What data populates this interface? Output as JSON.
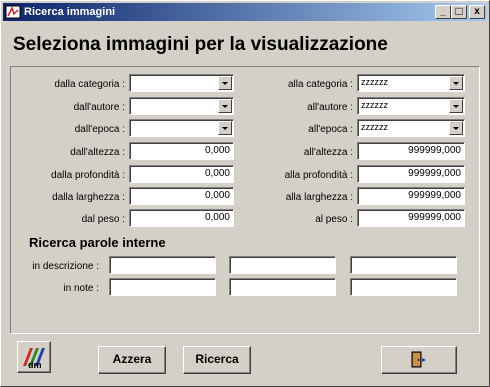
{
  "window": {
    "title": "Ricerca immagini",
    "minimize": "_",
    "maximize": "□",
    "close": "x"
  },
  "heading": "Seleziona immagini per la visualizzazione",
  "from": {
    "categoria": {
      "label": "dalla categoria :",
      "value": ""
    },
    "autore": {
      "label": "dall'autore :",
      "value": ""
    },
    "epoca": {
      "label": "dall'epoca :",
      "value": ""
    },
    "altezza": {
      "label": "dall'altezza :",
      "value": "0,000"
    },
    "profondita": {
      "label": "dalla profondità :",
      "value": "0,000"
    },
    "larghezza": {
      "label": "dalla larghezza :",
      "value": "0,000"
    },
    "peso": {
      "label": "dal peso :",
      "value": "0,000"
    }
  },
  "to": {
    "categoria": {
      "label": "alla categoria :",
      "value": "zzzzzz"
    },
    "autore": {
      "label": "all'autore :",
      "value": "zzzzzz"
    },
    "epoca": {
      "label": "all'epoca :",
      "value": "zzzzzz"
    },
    "altezza": {
      "label": "all'altezza :",
      "value": "999999,000"
    },
    "profondita": {
      "label": "alla profondità :",
      "value": "999999,000"
    },
    "larghezza": {
      "label": "alla larghezza :",
      "value": "999999,000"
    },
    "peso": {
      "label": "al peso :",
      "value": "999999,000"
    }
  },
  "keywords": {
    "title": "Ricerca parole interne",
    "descrizione_label": "in descrizione :",
    "note_label": "in note :",
    "descrizione": [
      "",
      "",
      ""
    ],
    "note": [
      "",
      "",
      ""
    ]
  },
  "buttons": {
    "logo_text": "dm",
    "reset": "Azzera",
    "search": "Ricerca",
    "exit_icon": "exit-door-icon"
  },
  "colors": {
    "face": "#d4d0c8",
    "title_start": "#0a246a",
    "title_end": "#a6caf0",
    "logo_red": "#cc2a1e",
    "logo_green": "#2a8a2a",
    "logo_blue": "#1e3ca8"
  }
}
